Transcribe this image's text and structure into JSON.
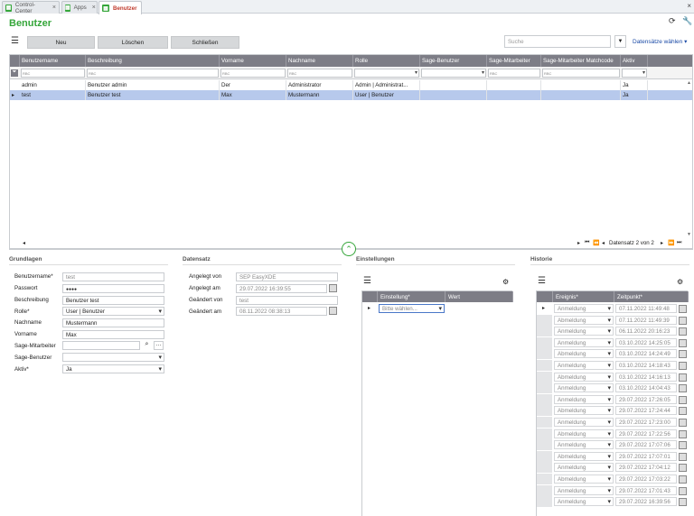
{
  "tabs": [
    {
      "label": "Control-Center",
      "active": false
    },
    {
      "label": "Apps",
      "active": false
    },
    {
      "label": "Benutzer",
      "active": true
    }
  ],
  "page_title": "Benutzer",
  "toolbar": {
    "new": "Neu",
    "delete": "Löschen",
    "close": "Schließen",
    "search_placeholder": "Suche",
    "select_records": "Datensätze wählen"
  },
  "grid": {
    "columns": [
      "Benutzername",
      "Beschreibung",
      "Vorname",
      "Nachname",
      "Rolle",
      "Sage-Benutzer",
      "Sage-Mitarbeiter",
      "Sage-Mitarbeiter Matchcode",
      "Aktiv"
    ],
    "filter_placeholder": "RBC",
    "rows": [
      {
        "cells": [
          "admin",
          "Benutzer admin",
          "Der",
          "Administrator",
          "Admin | Administrat...",
          "",
          "",
          "",
          "Ja"
        ],
        "selected": false
      },
      {
        "cells": [
          "test",
          "Benutzer test",
          "Max",
          "Mustermann",
          "User | Benutzer",
          "",
          "",
          "",
          "Ja"
        ],
        "selected": true
      }
    ],
    "record_status": "Datensatz 2 von 2"
  },
  "grundlagen": {
    "title": "Grundlagen",
    "fields": [
      {
        "label": "Benutzername*",
        "value": "test",
        "readonly": true
      },
      {
        "label": "Passwort",
        "value": "●●●●",
        "readonly": false
      },
      {
        "label": "Beschreibung",
        "value": "Benutzer test",
        "readonly": false
      },
      {
        "label": "Rolle*",
        "value": "User | Benutzer",
        "readonly": false
      },
      {
        "label": "Nachname",
        "value": "Mustermann",
        "readonly": false
      },
      {
        "label": "Vorname",
        "value": "Max",
        "readonly": false
      },
      {
        "label": "Sage-Mitarbeiter",
        "value": "",
        "readonly": false
      },
      {
        "label": "Sage-Benutzer",
        "value": "",
        "readonly": false
      },
      {
        "label": "Aktiv*",
        "value": "Ja",
        "readonly": false
      }
    ]
  },
  "datensatz": {
    "title": "Datensatz",
    "fields": [
      {
        "label": "Angelegt von",
        "value": "SEP EasyXDE"
      },
      {
        "label": "Angelegt am",
        "value": "29.07.2022 16:39:55"
      },
      {
        "label": "Geändert von",
        "value": "test"
      },
      {
        "label": "Geändert am",
        "value": "08.11.2022 08:38:13"
      }
    ]
  },
  "einstellungen": {
    "title": "Einstellungen",
    "col_setting": "Einstellung*",
    "col_value": "Wert",
    "placeholder": "Bitte wählen..."
  },
  "historie": {
    "title": "Historie",
    "col_event": "Ereignis*",
    "col_time": "Zeitpunkt*",
    "rows": [
      {
        "event": "Anmeldung",
        "time": "07.11.2022 11:49:48"
      },
      {
        "event": "Abmeldung",
        "time": "07.11.2022 11:49:39"
      },
      {
        "event": "Anmeldung",
        "time": "06.11.2022 20:16:23"
      },
      {
        "event": "Anmeldung",
        "time": "03.10.2022 14:25:05"
      },
      {
        "event": "Abmeldung",
        "time": "03.10.2022 14:24:49"
      },
      {
        "event": "Anmeldung",
        "time": "03.10.2022 14:18:43"
      },
      {
        "event": "Abmeldung",
        "time": "03.10.2022 14:16:13"
      },
      {
        "event": "Anmeldung",
        "time": "03.10.2022 14:04:43"
      },
      {
        "event": "Anmeldung",
        "time": "29.07.2022 17:26:05"
      },
      {
        "event": "Abmeldung",
        "time": "29.07.2022 17:24:44"
      },
      {
        "event": "Anmeldung",
        "time": "29.07.2022 17:23:00"
      },
      {
        "event": "Abmeldung",
        "time": "29.07.2022 17:22:56"
      },
      {
        "event": "Anmeldung",
        "time": "29.07.2022 17:07:06"
      },
      {
        "event": "Abmeldung",
        "time": "29.07.2022 17:07:01"
      },
      {
        "event": "Anmeldung",
        "time": "29.07.2022 17:04:12"
      },
      {
        "event": "Abmeldung",
        "time": "29.07.2022 17:03:22"
      },
      {
        "event": "Anmeldung",
        "time": "29.07.2022 17:01:43"
      },
      {
        "event": "Anmeldung",
        "time": "29.07.2022 16:39:56"
      }
    ]
  }
}
